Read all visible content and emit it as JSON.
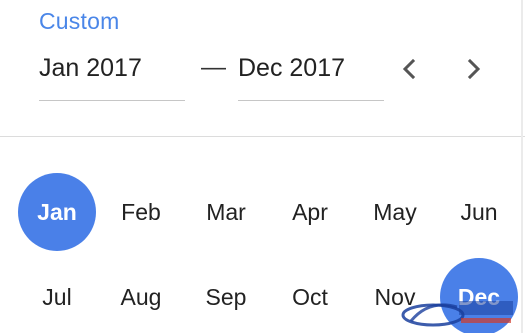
{
  "header": {
    "custom_label": "Custom",
    "start_value": "Jan 2017",
    "range_separator": "—",
    "end_value": "Dec 2017",
    "prev_icon": "chevron-left-icon",
    "next_icon": "chevron-right-icon"
  },
  "months": {
    "row1": [
      "Jan",
      "Feb",
      "Mar",
      "Apr",
      "May",
      "Jun"
    ],
    "row2": [
      "Jul",
      "Aug",
      "Sep",
      "Oct",
      "Nov",
      "Dec"
    ],
    "selected_start": "Jan",
    "selected_end": "Dec"
  },
  "colors": {
    "accent": "#4a80e8",
    "text": "#222222",
    "divider": "#dcdcdc"
  }
}
